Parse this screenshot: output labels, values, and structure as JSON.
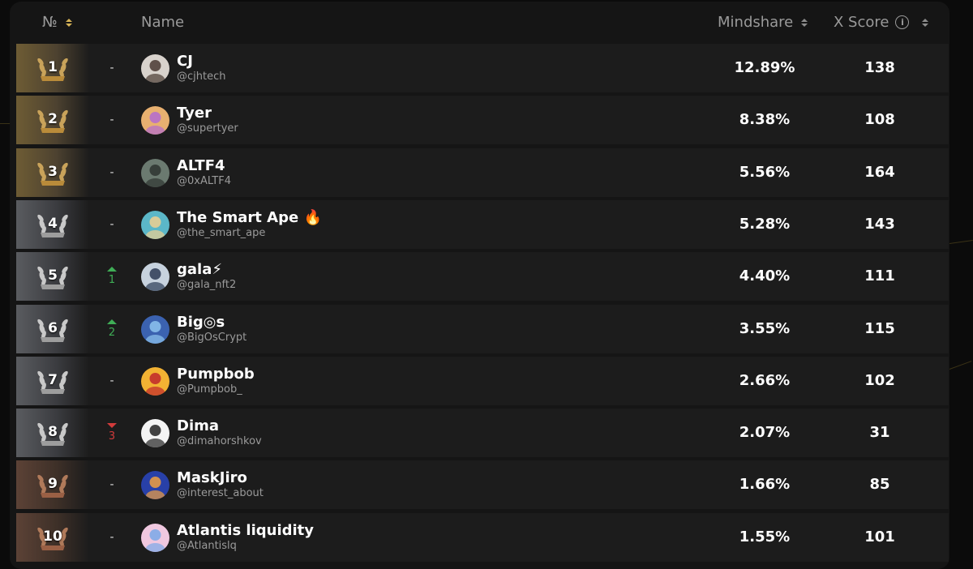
{
  "header": {
    "rank_label": "№",
    "name_label": "Name",
    "mindshare_label": "Mindshare",
    "xscore_label": "X Score",
    "info_glyph": "i"
  },
  "rows": [
    {
      "rank": "1",
      "tier": "gold",
      "change": "-",
      "change_dir": "none",
      "name": "CJ",
      "handle": "@cjhtech",
      "mindshare": "12.89%",
      "xscore": "138",
      "avatar_color": "#d8d2cc",
      "avatar_accent": "#4a3a32"
    },
    {
      "rank": "2",
      "tier": "gold",
      "change": "-",
      "change_dir": "none",
      "name": "Tyer",
      "handle": "@supertyer",
      "mindshare": "8.38%",
      "xscore": "108",
      "avatar_color": "#e8b070",
      "avatar_accent": "#b36bd0"
    },
    {
      "rank": "3",
      "tier": "gold",
      "change": "-",
      "change_dir": "none",
      "name": "ALTF4",
      "handle": "@0xALTF4",
      "mindshare": "5.56%",
      "xscore": "164",
      "avatar_color": "#6b7a70",
      "avatar_accent": "#2e3530"
    },
    {
      "rank": "4",
      "tier": "silver",
      "change": "-",
      "change_dir": "none",
      "name": "The Smart Ape 🔥",
      "handle": "@the_smart_ape",
      "mindshare": "5.28%",
      "xscore": "143",
      "avatar_color": "#5bb7c8",
      "avatar_accent": "#f0d090"
    },
    {
      "rank": "5",
      "tier": "silver",
      "change": "1",
      "change_dir": "up",
      "name": "gala⚡",
      "handle": "@gala_nft2",
      "mindshare": "4.40%",
      "xscore": "111",
      "avatar_color": "#c7d2de",
      "avatar_accent": "#2b3a55"
    },
    {
      "rank": "6",
      "tier": "silver",
      "change": "2",
      "change_dir": "up",
      "name": "Big◎s",
      "handle": "@BigOsCrypt",
      "mindshare": "3.55%",
      "xscore": "115",
      "avatar_color": "#3b62b0",
      "avatar_accent": "#8ec4f0"
    },
    {
      "rank": "7",
      "tier": "silver",
      "change": "-",
      "change_dir": "none",
      "name": "Pumpbob",
      "handle": "@Pumpbob_",
      "mindshare": "2.66%",
      "xscore": "102",
      "avatar_color": "#f2b233",
      "avatar_accent": "#c0262b"
    },
    {
      "rank": "8",
      "tier": "silver",
      "change": "3",
      "change_dir": "down",
      "name": "Dima",
      "handle": "@dimahorshkov",
      "mindshare": "2.07%",
      "xscore": "31",
      "avatar_color": "#f4f4f4",
      "avatar_accent": "#222222"
    },
    {
      "rank": "9",
      "tier": "bronze",
      "change": "-",
      "change_dir": "none",
      "name": "MaskJiro",
      "handle": "@interest_about",
      "mindshare": "1.66%",
      "xscore": "85",
      "avatar_color": "#2840a8",
      "avatar_accent": "#f0a040"
    },
    {
      "rank": "10",
      "tier": "bronze",
      "change": "-",
      "change_dir": "none",
      "name": "Atlantis liquidity",
      "handle": "@Atlantislq",
      "mindshare": "1.55%",
      "xscore": "101",
      "avatar_color": "#f0c8e0",
      "avatar_accent": "#7aa8e8"
    }
  ],
  "colors": {
    "background": "#0b0b0b",
    "panel": "#151515",
    "row": "#1c1c1c",
    "up": "#3fae56",
    "down": "#d23b3b",
    "sort_active": "#d7b457"
  }
}
